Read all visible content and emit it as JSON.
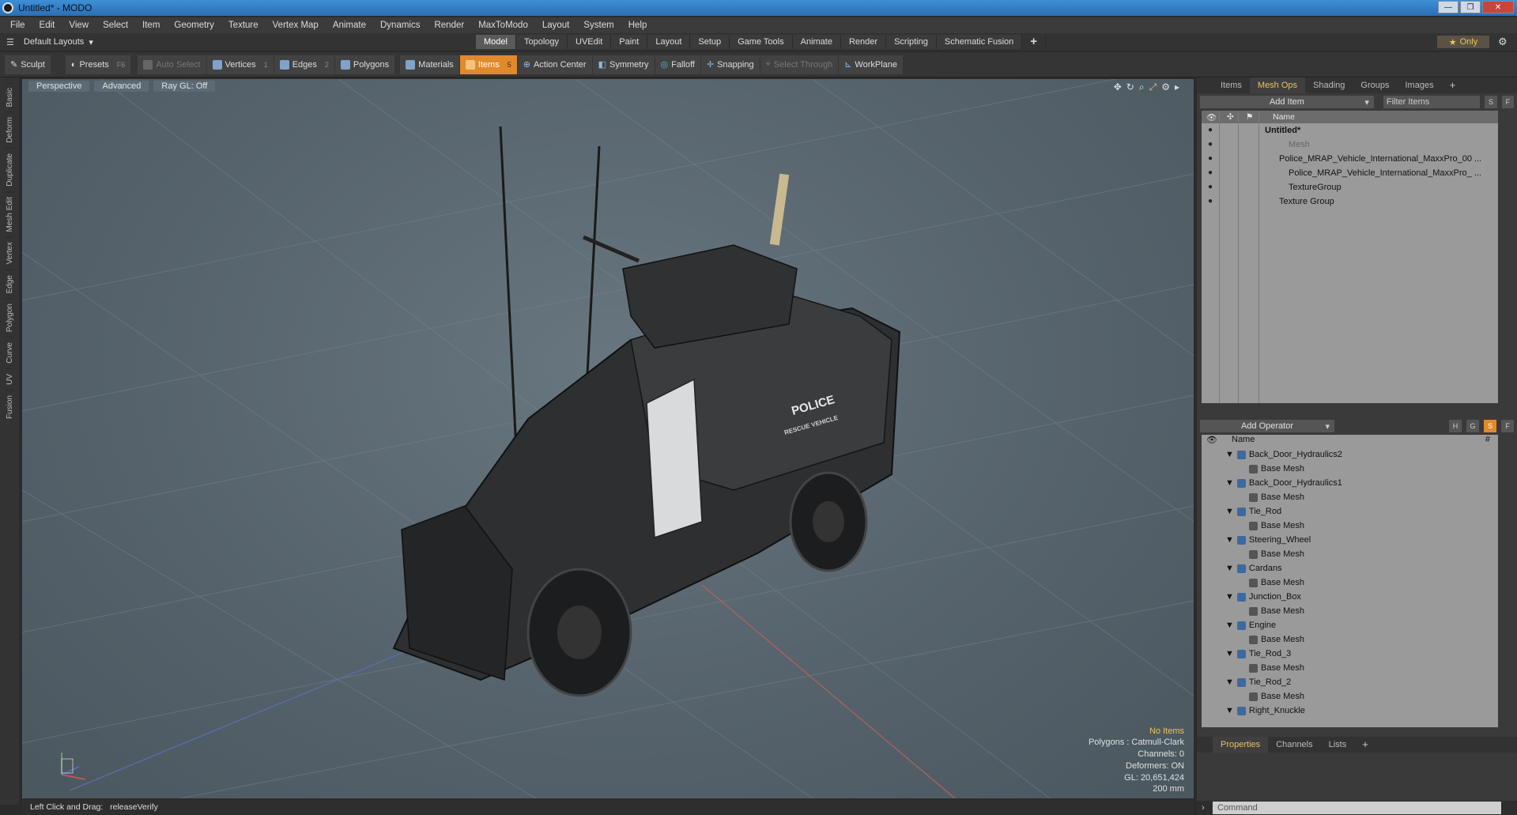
{
  "window": {
    "title": "Untitled* - MODO",
    "buttons": [
      "—",
      "❐",
      "✕"
    ]
  },
  "menu": [
    "File",
    "Edit",
    "View",
    "Select",
    "Item",
    "Geometry",
    "Texture",
    "Vertex Map",
    "Animate",
    "Dynamics",
    "Render",
    "MaxToModo",
    "Layout",
    "System",
    "Help"
  ],
  "layout": {
    "selector": "Default Layouts",
    "tabs": [
      "Model",
      "Topology",
      "UVEdit",
      "Paint",
      "Layout",
      "Setup",
      "Game Tools",
      "Animate",
      "Render",
      "Scripting",
      "Schematic Fusion"
    ],
    "active_tab": "Model",
    "only_label": "Only"
  },
  "toolbar": {
    "sculpt": "Sculpt",
    "presets": "Presets",
    "presets_key": "F6",
    "auto_select": "Auto Select",
    "vertices": "Vertices",
    "vertices_key": "1",
    "edges": "Edges",
    "edges_key": "2",
    "polygons": "Polygons",
    "materials": "Materials",
    "items": "Items",
    "items_key": "5",
    "action_center": "Action Center",
    "symmetry": "Symmetry",
    "falloff": "Falloff",
    "snapping": "Snapping",
    "select_through": "Select Through",
    "workplane": "WorkPlane"
  },
  "left_tabs": [
    "Basic",
    "Deform",
    "Duplicate",
    "Mesh Edit",
    "Vertex",
    "Edge",
    "Polygon",
    "Curve",
    "UV",
    "Fusion"
  ],
  "viewport": {
    "view": "Perspective",
    "shading": "Advanced",
    "raygl": "Ray GL: Off",
    "info": {
      "no_items": "No Items",
      "polygons": "Polygons : Catmull-Clark",
      "channels": "Channels: 0",
      "deformers": "Deformers: ON",
      "gl": "GL: 20,651,424",
      "scale": "200 mm"
    },
    "vehicle": {
      "police": "POLICE",
      "rescue": "RESCUE VEHICLE"
    }
  },
  "status": {
    "hint": "Left Click and Drag:",
    "cmd": "releaseVerify"
  },
  "panel_tabs": [
    "Items",
    "Mesh Ops",
    "Shading",
    "Groups",
    "Images"
  ],
  "panel_active": "Mesh Ops",
  "items_panel": {
    "add_item": "Add Item",
    "filter_placeholder": "Filter Items",
    "s": "S",
    "f": "F",
    "column": "Name",
    "rows": [
      {
        "label": "Untitled*",
        "indent": 1,
        "bold": true
      },
      {
        "label": "Mesh",
        "indent": 2,
        "dim": true
      },
      {
        "label": "Police_MRAP_Vehicle_International_MaxxPro_00 ...",
        "indent": 2
      },
      {
        "label": "Police_MRAP_Vehicle_International_MaxxPro_ ...",
        "indent": 3
      },
      {
        "label": "TextureGroup",
        "indent": 3
      },
      {
        "label": "Texture Group",
        "indent": 2
      }
    ]
  },
  "ops_panel": {
    "add_operator": "Add Operator",
    "h": "H",
    "g": "G",
    "s": "S",
    "f": "F",
    "column": "Name",
    "hash": "#",
    "rows": [
      {
        "label": "Back_Door_Hydraulics2",
        "child": "Base Mesh"
      },
      {
        "label": "Back_Door_Hydraulics1",
        "child": "Base Mesh"
      },
      {
        "label": "Tie_Rod",
        "child": "Base Mesh"
      },
      {
        "label": "Steering_Wheel",
        "child": "Base Mesh"
      },
      {
        "label": "Cardans",
        "child": "Base Mesh"
      },
      {
        "label": "Junction_Box",
        "child": "Base Mesh"
      },
      {
        "label": "Engine",
        "child": "Base Mesh"
      },
      {
        "label": "Tie_Rod_3",
        "child": "Base Mesh"
      },
      {
        "label": "Tie_Rod_2",
        "child": "Base Mesh"
      },
      {
        "label": "Right_Knuckle",
        "child": ""
      }
    ]
  },
  "bottom_tabs": [
    "Properties",
    "Channels",
    "Lists"
  ],
  "bottom_active": "Properties",
  "command": {
    "placeholder": "Command"
  }
}
